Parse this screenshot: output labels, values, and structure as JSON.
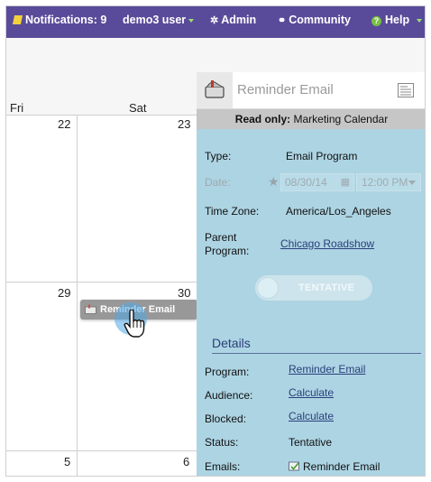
{
  "topbar": {
    "notifications": "Notifications: 9",
    "user": "demo3 user",
    "admin": "Admin",
    "community": "Community",
    "help": "Help"
  },
  "calendar": {
    "days": [
      "Fri",
      "Sat"
    ],
    "dates": [
      "22",
      "23",
      "29",
      "30",
      "5",
      "6"
    ],
    "event_label": "Reminder Email"
  },
  "panel": {
    "title": "Reminder Email",
    "readonly_bold": "Read only:",
    "readonly_text": " Marketing Calendar",
    "type_label": "Type:",
    "type_value": "Email Program",
    "date_label": "Date:",
    "date_value": "08/30/14",
    "time_value": "12:00 PM",
    "tz_label": "Time Zone:",
    "tz_value": "America/Los_Angeles",
    "parent_label_1": "Parent",
    "parent_label_2": "Program:",
    "parent_value": "Chicago Roadshow",
    "toggle_label": "TENTATIVE",
    "details_title": "Details",
    "program_label": "Program:",
    "program_value": "Reminder Email",
    "audience_label": "Audience:",
    "audience_value": "Calculate",
    "blocked_label": "Blocked:",
    "blocked_value": "Calculate",
    "status_label": "Status:",
    "status_value": "Tentative",
    "emails_label": "Emails:",
    "emails_value": "Reminder Email"
  },
  "colors": {
    "topbar": "#5a4b9a",
    "panel": "#add4e3",
    "link": "#2a3f7a"
  }
}
